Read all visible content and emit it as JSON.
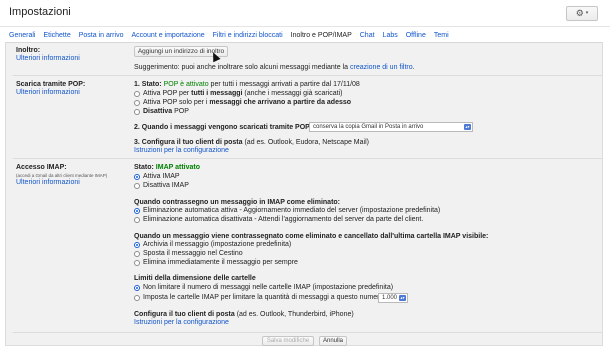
{
  "header": {
    "title": "Impostazioni",
    "gear_icon": "gear-icon",
    "gear_caret": "▾"
  },
  "tabs": [
    {
      "label": "Generali"
    },
    {
      "label": "Etichette"
    },
    {
      "label": "Posta in arrivo"
    },
    {
      "label": "Account e importazione"
    },
    {
      "label": "Filtri e indirizzi bloccati"
    },
    {
      "label": "Inoltro e POP/IMAP",
      "active": true
    },
    {
      "label": "Chat"
    },
    {
      "label": "Labs"
    },
    {
      "label": "Offline"
    },
    {
      "label": "Temi"
    }
  ],
  "forwarding": {
    "label": "Inoltro:",
    "more_info": "Ulteriori informazioni",
    "add_button": "Aggiungi un indirizzo di inoltro",
    "tip_prefix": "Suggerimento: puoi anche inoltrare solo alcuni messaggi mediante la",
    "tip_link": "creazione di un filtro",
    "tip_suffix": "."
  },
  "pop": {
    "label": "Scarica tramite POP:",
    "more_info": "Ulteriori informazioni",
    "status_prefix": "1. Stato:",
    "status_value": "POP è attivato",
    "status_suffix": "per tutti i messaggi arrivati a partire dal 17/11/08",
    "options": [
      {
        "pre": "Attiva POP per",
        "bold": "tutti i messaggi",
        "post": "(anche i messaggi già scaricati)",
        "selected": false
      },
      {
        "pre": "Attiva POP solo per i",
        "bold": "messaggi che arrivano a partire da adesso",
        "post": "",
        "selected": false
      },
      {
        "pre": "",
        "bold": "Disattiva",
        "post": "POP",
        "selected": false
      }
    ],
    "step2_label": "2. Quando i messaggi vengono scaricati tramite POP",
    "step2_select": "conserva la copia Gmail in Posta in arrivo",
    "step3_label": "3. Configura il tuo client di posta",
    "step3_suffix": "(ad es. Outlook, Eudora, Netscape Mail)",
    "step3_link": "Istruzioni per la configurazione"
  },
  "imap": {
    "label": "Accesso IMAP:",
    "sublabel": "(accedi a Gmail da altri client mediante IMAP)",
    "more_info": "Ulteriori informazioni",
    "status_prefix": "Stato:",
    "status_value": "IMAP attivato",
    "options": [
      {
        "label": "Attiva IMAP",
        "selected": true
      },
      {
        "label": "Disattiva IMAP",
        "selected": false
      }
    ],
    "deleted_heading": "Quando contrassegno un messaggio in IMAP come eliminato:",
    "deleted_options": [
      {
        "label": "Eliminazione automatica attiva - Aggiornamento immediato del server (impostazione predefinita)",
        "selected": true
      },
      {
        "label": "Eliminazione automatica disattivata - Attendi l'aggiornamento del server da parte del client.",
        "selected": false
      }
    ],
    "expunge_heading": "Quando un messaggio viene contrassegnato come eliminato e cancellato dall'ultima cartella IMAP visibile:",
    "expunge_options": [
      {
        "label": "Archivia il messaggio (impostazione predefinita)",
        "selected": true
      },
      {
        "label": "Sposta il messaggio nel Cestino",
        "selected": false
      },
      {
        "label": "Elimina immediatamente il messaggio per sempre",
        "selected": false
      }
    ],
    "folder_heading": "Limiti della dimensione delle cartelle",
    "folder_options": [
      {
        "label": "Non limitare il numero di messaggi nelle cartelle IMAP (impostazione predefinita)",
        "selected": true
      },
      {
        "label": "Imposta le cartelle IMAP per limitare la quantità di messaggi a questo numero",
        "selected": false
      }
    ],
    "folder_limit": "1.000",
    "config_label": "Configura il tuo client di posta",
    "config_suffix": "(ad es. Outlook, Thunderbird, iPhone)",
    "config_link": "Istruzioni per la configurazione"
  },
  "footer": {
    "save": "Salva modifiche",
    "cancel": "Annulla"
  }
}
